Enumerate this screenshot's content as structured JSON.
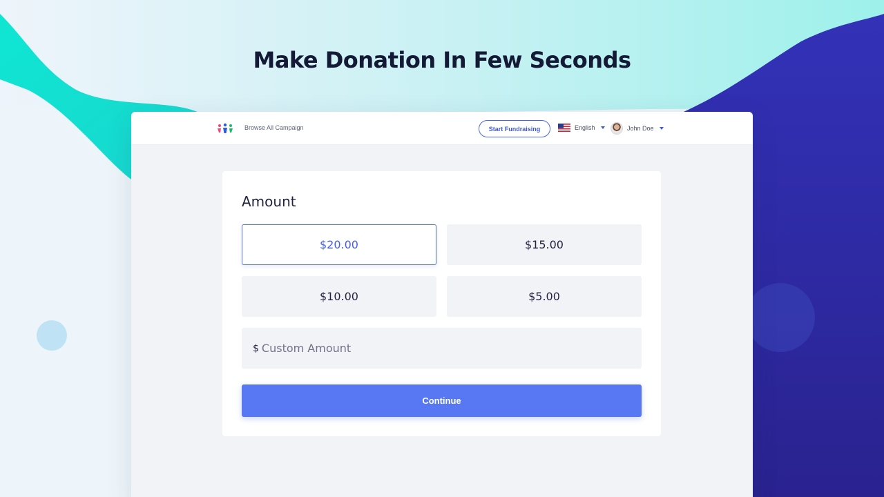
{
  "headline": "Make Donation In Few Seconds",
  "navbar": {
    "logo_icon": "donation-people-icon",
    "browse_label": "Browse All Campaign",
    "start_button": "Start Fundraising",
    "language": {
      "label": "English",
      "flag_icon": "us-flag-icon"
    },
    "user": {
      "name": "John Doe",
      "avatar_icon": "user-avatar"
    }
  },
  "donation": {
    "title": "Amount",
    "amounts": [
      "$20.00",
      "$15.00",
      "$10.00",
      "$5.00"
    ],
    "selected": "$20.00",
    "custom": {
      "currency": "$",
      "placeholder": "Custom Amount"
    },
    "continue_label": "Continue"
  },
  "colors": {
    "accent": "#5778f2",
    "teal": "#12e3cf",
    "indigo": "#2b2597",
    "heading": "#141936"
  }
}
